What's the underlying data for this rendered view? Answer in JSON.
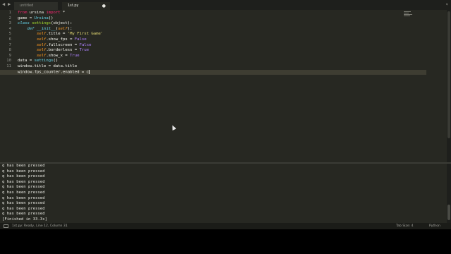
{
  "tabs": [
    {
      "label": "untitled",
      "active": false
    },
    {
      "label": "1st.py",
      "active": true
    }
  ],
  "editor": {
    "line_numbers": [
      "1",
      "2",
      "3",
      "4",
      "5",
      "6",
      "7",
      "8",
      "9",
      "10",
      "11",
      "12"
    ],
    "current_line": 12
  },
  "output": {
    "lines": [
      "q has been pressed",
      "q has been pressed",
      "q has been pressed",
      "q has been pressed",
      "q has been pressed",
      "q has been pressed",
      "q has been pressed",
      "q has been pressed",
      "q has been pressed",
      "q has been pressed",
      "[Finished in 33.3s]"
    ]
  },
  "status": {
    "message": "1st.py: Ready, Line 12, Column 31",
    "tab_size": "Tab Size: 4",
    "syntax": "Python"
  },
  "colors": {
    "editor_bg": "#272822",
    "keyword": "#f92672",
    "string": "#e6db74",
    "builtin": "#66d9ef",
    "self": "#fd971f",
    "boolean": "#ae81ff"
  }
}
